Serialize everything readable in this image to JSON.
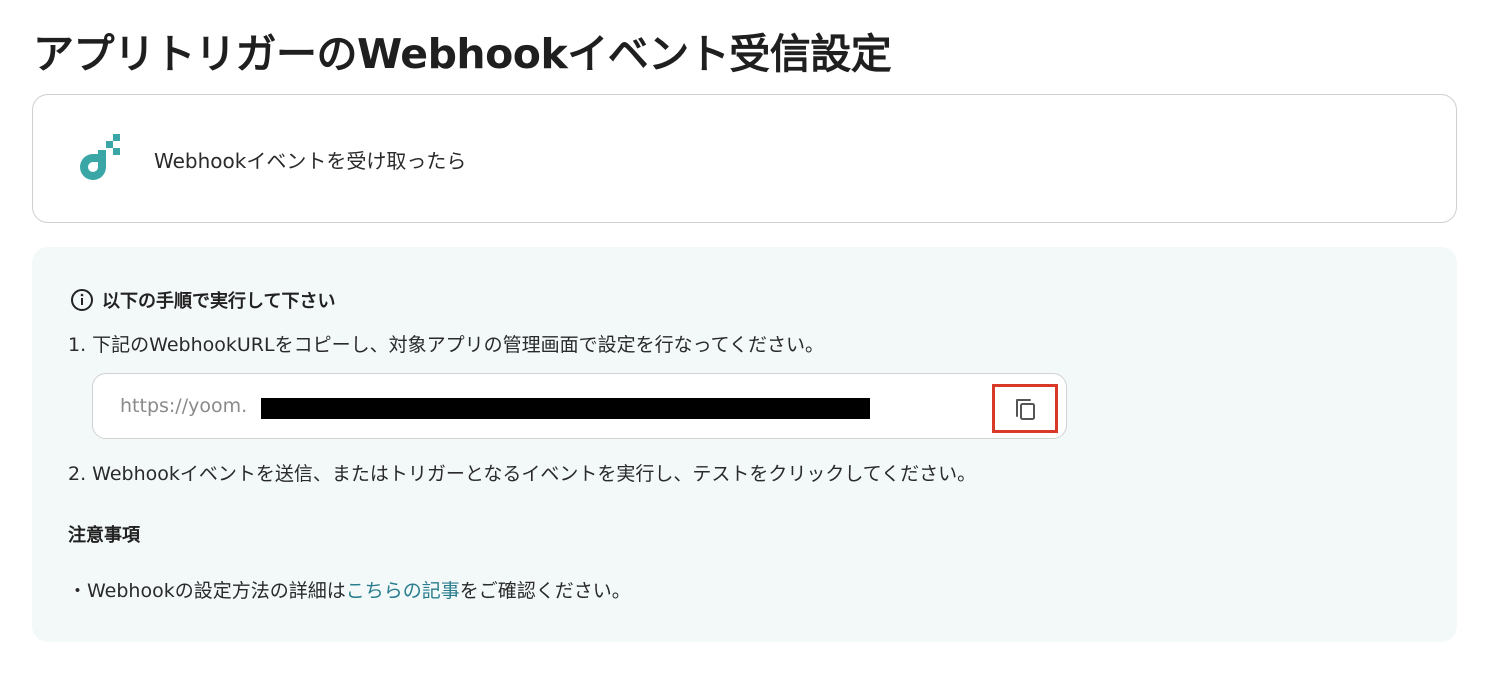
{
  "page": {
    "title": "アプリトリガーのWebhookイベント受信設定"
  },
  "trigger": {
    "label": "Webhookイベントを受け取ったら",
    "logo_icon": "yoom-webhook-logo",
    "logo_color": "#3aa6a6"
  },
  "instructions": {
    "icon": "info-icon",
    "heading": "以下の手順で実行して下さい",
    "step1": "1. 下記のWebhookURLをコピーし、対象アプリの管理画面で設定を行なってください。",
    "url_value": "https://yoom.",
    "copy_icon": "copy-icon",
    "step2": "2. Webhookイベントを送信、またはトリガーとなるイベントを実行し、テストをクリックしてください。"
  },
  "notes": {
    "heading": "注意事項",
    "line_prefix": "・Webhookの設定方法の詳細は",
    "link_text": "こちらの記事",
    "line_suffix": "をご確認ください。"
  },
  "colors": {
    "panel_background": "#f3f9f9",
    "link": "#2a7d8e",
    "highlight_border": "#d83a27"
  }
}
